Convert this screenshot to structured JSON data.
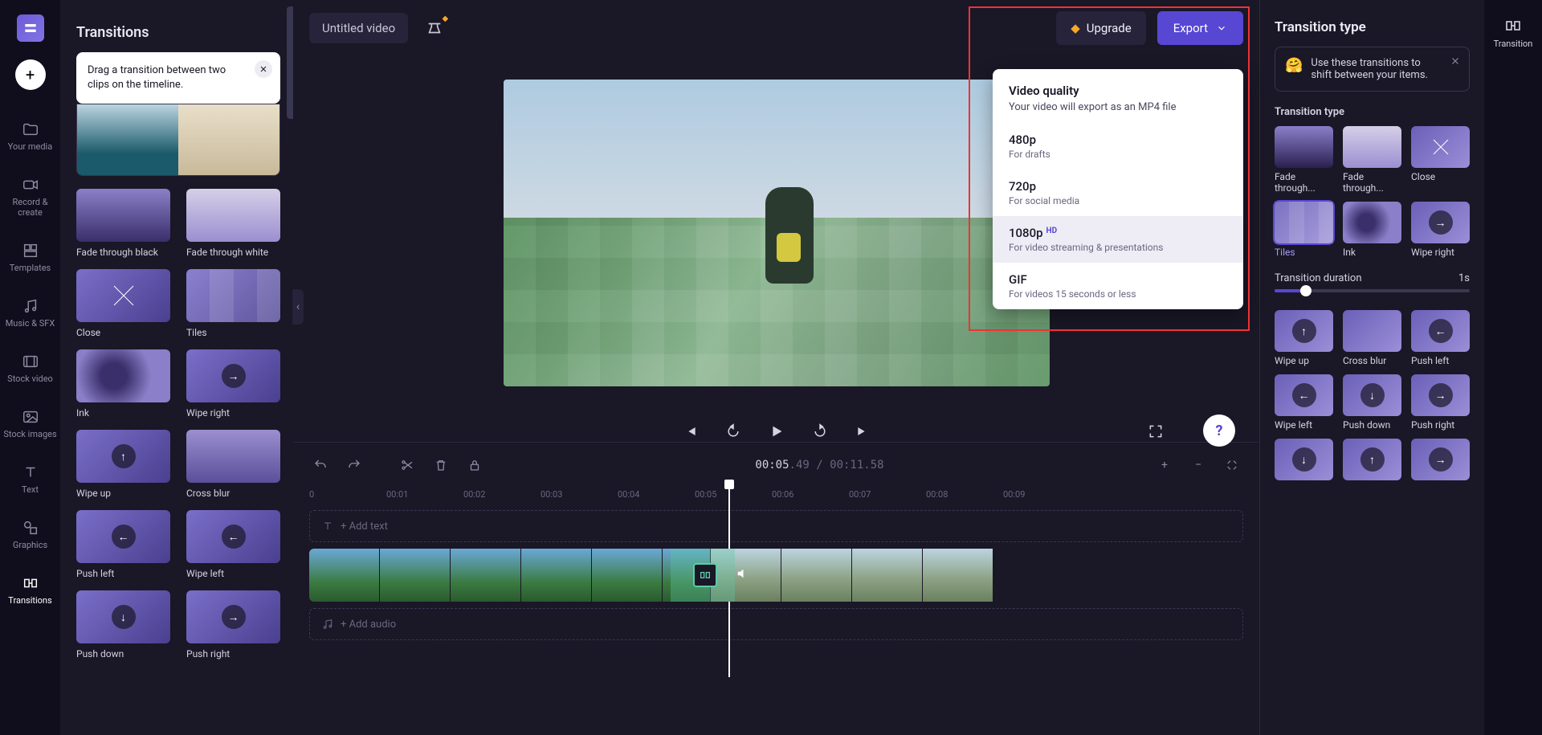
{
  "rail": {
    "items": [
      {
        "label": "Your media"
      },
      {
        "label": "Record & create"
      },
      {
        "label": "Templates"
      },
      {
        "label": "Music & SFX"
      },
      {
        "label": "Stock video"
      },
      {
        "label": "Stock images"
      },
      {
        "label": "Text"
      },
      {
        "label": "Graphics"
      },
      {
        "label": "Transitions"
      }
    ]
  },
  "left_panel": {
    "title": "Transitions",
    "tip": "Drag a transition between two clips on the timeline.",
    "thumbs": [
      {
        "label": "Fade through black"
      },
      {
        "label": "Fade through white"
      },
      {
        "label": "Close"
      },
      {
        "label": "Tiles"
      },
      {
        "label": "Ink"
      },
      {
        "label": "Wipe right"
      },
      {
        "label": "Wipe up"
      },
      {
        "label": "Cross blur"
      },
      {
        "label": "Push left"
      },
      {
        "label": "Wipe left"
      },
      {
        "label": "Push down"
      },
      {
        "label": "Push right"
      }
    ]
  },
  "topbar": {
    "video_title": "Untitled video",
    "upgrade": "Upgrade",
    "export": "Export"
  },
  "export_menu": {
    "heading": "Video quality",
    "subheading": "Your video will export as an MP4 file",
    "options": [
      {
        "quality": "480p",
        "desc": "For drafts",
        "hd": false
      },
      {
        "quality": "720p",
        "desc": "For social media",
        "hd": false
      },
      {
        "quality": "1080p",
        "desc": "For video streaming & presentations",
        "hd": true
      },
      {
        "quality": "GIF",
        "desc": "For videos 15 seconds or less",
        "hd": false
      }
    ]
  },
  "timeline": {
    "current": "00:05",
    "current_frac": ".49",
    "total": "00:11",
    "total_frac": ".58",
    "add_text": "+ Add text",
    "add_audio": "+ Add audio",
    "ticks": [
      "0",
      "00:01",
      "00:02",
      "00:03",
      "00:04",
      "00:05",
      "00:06",
      "00:07",
      "00:08",
      "00:09"
    ]
  },
  "right": {
    "title": "Transition type",
    "tip": "Use these transitions to shift between your items.",
    "section_type": "Transition type",
    "types": [
      {
        "label": "Fade through..."
      },
      {
        "label": "Fade through..."
      },
      {
        "label": "Close"
      },
      {
        "label": "Tiles"
      },
      {
        "label": "Ink"
      },
      {
        "label": "Wipe right"
      },
      {
        "label": "Wipe up"
      },
      {
        "label": "Cross blur"
      },
      {
        "label": "Push left"
      },
      {
        "label": "Wipe left"
      },
      {
        "label": "Push down"
      },
      {
        "label": "Push right"
      }
    ],
    "selected_index": 3,
    "duration_label": "Transition duration",
    "duration_value": "1s"
  },
  "far_rail": {
    "label": "Transition"
  }
}
